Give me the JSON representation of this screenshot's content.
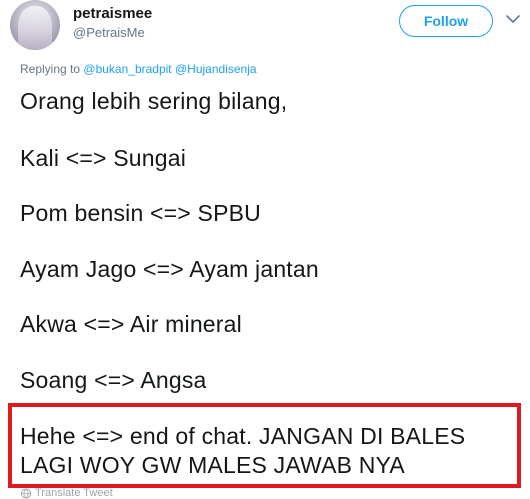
{
  "user": {
    "display_name": "petraismee",
    "handle": "@PetraisMe",
    "avatar_icon": "profile-avatar"
  },
  "follow_button": {
    "label": "Follow",
    "color": "#1da1f2"
  },
  "reply_context": {
    "prefix": "Replying to",
    "mention_1": "@bukan_bradpit",
    "mention_2": "@Hujandisenja"
  },
  "tweet": {
    "lines": [
      "Orang lebih sering bilang,",
      "Kali <=> Sungai",
      "Pom bensin <=> SPBU",
      "Ayam Jago <=> Ayam jantan",
      "Akwa <=> Air mineral",
      "Soang <=> Angsa",
      "Hehe <=> end of chat. JANGAN DI BALES",
      "LAGI WOY GW MALES JAWAB NYA"
    ]
  },
  "highlight": {
    "color": "#e0191f"
  },
  "translate": {
    "label": "Translate Tweet"
  }
}
